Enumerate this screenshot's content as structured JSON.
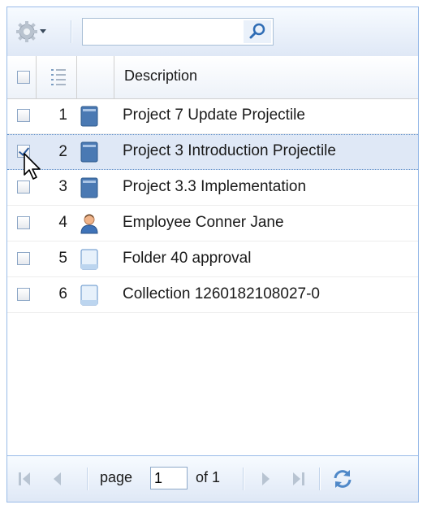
{
  "toolbar": {
    "gear_icon": "gear-icon",
    "search": {
      "value": "",
      "placeholder": "",
      "icon": "search-icon"
    }
  },
  "grid": {
    "columns": [
      {
        "key": "select",
        "label": ""
      },
      {
        "key": "number",
        "label": "",
        "icon": "numbered-list-icon"
      },
      {
        "key": "type",
        "label": ""
      },
      {
        "key": "description",
        "label": "Description"
      }
    ],
    "rows": [
      {
        "number": "1",
        "type_icon": "project-icon",
        "description": "Project 7 Update Projectile",
        "checked": false
      },
      {
        "number": "2",
        "type_icon": "project-icon",
        "description": "Project 3 Introduction Projectile",
        "checked": true
      },
      {
        "number": "3",
        "type_icon": "project-icon",
        "description": "Project 3.3 Implementation",
        "checked": false
      },
      {
        "number": "4",
        "type_icon": "employee-icon",
        "description": "Employee Conner Jane",
        "checked": false
      },
      {
        "number": "5",
        "type_icon": "document-icon",
        "description": "Folder 40 approval",
        "checked": false
      },
      {
        "number": "6",
        "type_icon": "document-icon",
        "description": "Collection 1260182108027-0",
        "checked": false
      }
    ]
  },
  "pager": {
    "page_label": "page",
    "current_page": "1",
    "of_label": "of 1"
  },
  "colors": {
    "border": "#99bbe8",
    "selected_row": "#dfe8f6",
    "project_icon": "#4a79b3"
  }
}
